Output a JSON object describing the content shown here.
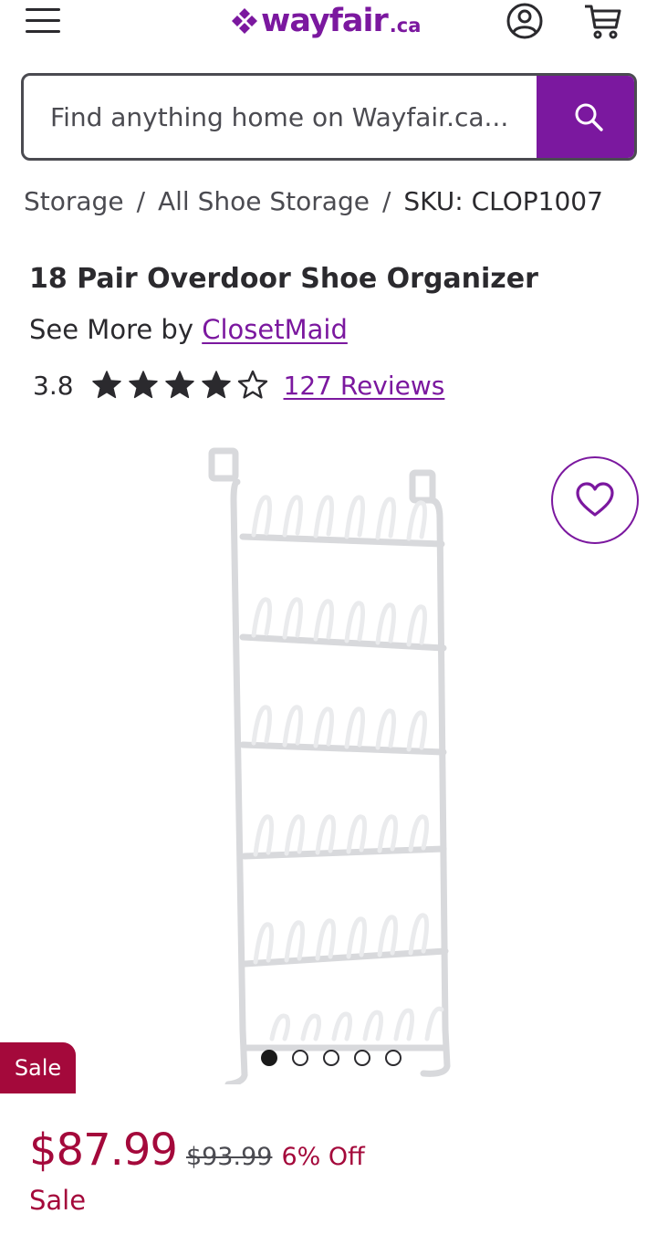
{
  "header": {
    "logo_text": "wayfair",
    "logo_suffix": ".ca",
    "menu_icon": "hamburger-menu-icon",
    "account_icon": "account-icon",
    "cart_icon": "cart-icon"
  },
  "search": {
    "placeholder": "Find anything home on Wayfair.ca...",
    "icon": "search-icon"
  },
  "breadcrumb": {
    "items": [
      "Storage",
      "All Shoe Storage"
    ],
    "separator": "/",
    "current": "SKU: CLOP1007"
  },
  "product": {
    "title": "18 Pair Overdoor Shoe Organizer",
    "see_more_prefix": "See More by",
    "brand": "ClosetMaid",
    "rating": "3.8",
    "rating_value": 3.8,
    "rating_max": 5,
    "reviews_label": "127 Reviews"
  },
  "gallery": {
    "image_description_icon": "shoe-rack-image",
    "favorite_icon": "heart-icon",
    "dot_count": 5,
    "active_dot": 0,
    "sale_badge": "Sale"
  },
  "pricing": {
    "price": "$87.99",
    "original_price": "$93.99",
    "discount": "6% Off",
    "sale_label": "Sale"
  },
  "colors": {
    "brand_purple": "#7b189f",
    "sale_red": "#a4093b",
    "text_dark": "#2b2a2e"
  }
}
